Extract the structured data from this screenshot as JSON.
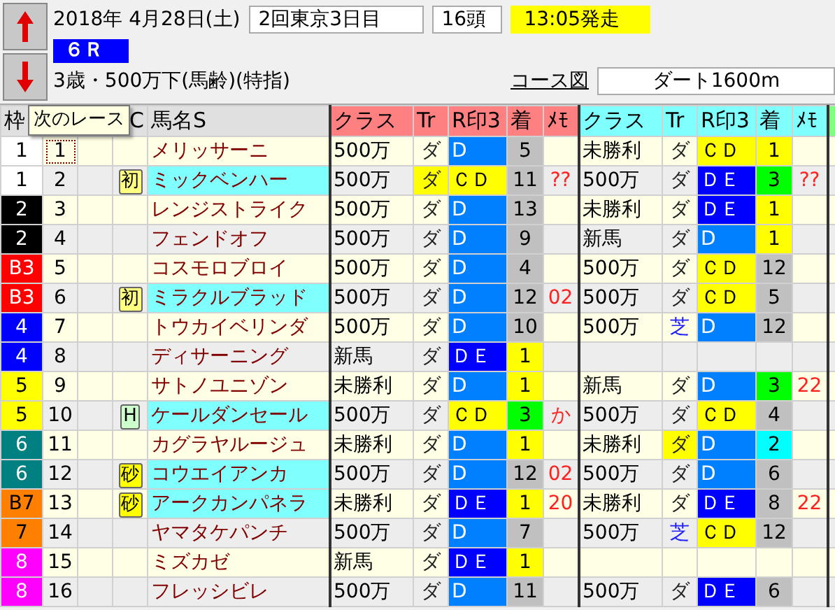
{
  "header": {
    "date": "2018年 4月28日(土)",
    "meeting": "2回東京3日目",
    "runners": "16頭",
    "start": "13:05発走",
    "race": "６Ｒ",
    "condition": "3歳・500万下(馬齢)(特指)",
    "course_link": "コース図",
    "course": "ダート1600m"
  },
  "tooltip": "次のレース",
  "table": {
    "columns": [
      {
        "label": "枠",
        "color": "#e0e0e0"
      },
      {
        "label": "C",
        "color": "#e0e0e0"
      },
      {
        "label": "馬名S",
        "color": "#e0e0e0"
      },
      {
        "label": "クラス",
        "color": "#ff8080"
      },
      {
        "label": "Tr",
        "color": "#ff8080"
      },
      {
        "label": "R印3",
        "color": "#ff8080"
      },
      {
        "label": "着",
        "color": "#ff8080"
      },
      {
        "label": "ﾒﾓ",
        "color": "#ff8080"
      },
      {
        "label": "クラス",
        "color": "#80ffff"
      },
      {
        "label": "Tr",
        "color": "#80ffff"
      },
      {
        "label": "R印3",
        "color": "#80ffff"
      },
      {
        "label": "着",
        "color": "#80ffff"
      },
      {
        "label": "ﾒﾓ",
        "color": "#80ffff"
      },
      {
        "color": "#80ff80"
      }
    ],
    "rows": [
      {
        "waku": {
          "text": "1",
          "color": "#ffffff"
        },
        "number": "1",
        "selected": true,
        "name": "メリッサーニ",
        "name_highlighted": false,
        "runs": [
          {
            "kind": "result",
            "class": "500万",
            "track": {
              "text": "ダ",
              "kind": "dirt",
              "highlighted": false
            },
            "grade": {
              "text": "D",
              "color": "#0080ff"
            },
            "rank": {
              "text": "5",
              "color": "#c0c0c0"
            }
          },
          {
            "kind": "result",
            "class": "未勝利",
            "track": {
              "text": "ダ",
              "kind": "dirt",
              "highlighted": false
            },
            "grade": {
              "text": "ＣＤ",
              "color": "#ffff00"
            },
            "rank": {
              "text": "1",
              "color": "#ffff00"
            }
          }
        ]
      },
      {
        "waku": {
          "text": "1",
          "color": "#ffffff"
        },
        "number": "2",
        "selected": false,
        "mark": {
          "text": "初",
          "color": "#ffff80"
        },
        "name": "ミックベンハー",
        "name_highlighted": true,
        "runs": [
          {
            "kind": "result",
            "class": "500万",
            "track": {
              "text": "ダ",
              "kind": "dirt",
              "highlighted": true
            },
            "grade": {
              "text": "ＣＤ",
              "color": "#ffff00"
            },
            "rank": {
              "text": "11",
              "color": "#c0c0c0"
            },
            "memo": "??"
          },
          {
            "kind": "result",
            "class": "500万",
            "track": {
              "text": "ダ",
              "kind": "dirt",
              "highlighted": false
            },
            "grade": {
              "text": "ＤＥ",
              "color": "#0000ff"
            },
            "rank": {
              "text": "3",
              "color": "#00ff00"
            },
            "memo": "??"
          }
        ]
      },
      {
        "waku": {
          "text": "2",
          "color": "#000000"
        },
        "number": "3",
        "selected": false,
        "name": "レンジストライク",
        "name_highlighted": false,
        "runs": [
          {
            "kind": "result",
            "class": "500万",
            "track": {
              "text": "ダ",
              "kind": "dirt",
              "highlighted": false
            },
            "grade": {
              "text": "D",
              "color": "#0080ff"
            },
            "rank": {
              "text": "13",
              "color": "#c0c0c0"
            }
          },
          {
            "kind": "result",
            "class": "未勝利",
            "track": {
              "text": "ダ",
              "kind": "dirt",
              "highlighted": false
            },
            "grade": {
              "text": "ＤＥ",
              "color": "#0000ff"
            },
            "rank": {
              "text": "1",
              "color": "#ffff00"
            }
          }
        ]
      },
      {
        "waku": {
          "text": "2",
          "color": "#000000"
        },
        "number": "4",
        "selected": false,
        "name": "フェンドオフ",
        "name_highlighted": false,
        "runs": [
          {
            "kind": "result",
            "class": "500万",
            "track": {
              "text": "ダ",
              "kind": "dirt",
              "highlighted": false
            },
            "grade": {
              "text": "D",
              "color": "#0080ff"
            },
            "rank": {
              "text": "9",
              "color": "#c0c0c0"
            }
          },
          {
            "kind": "result",
            "class": "新馬",
            "track": {
              "text": "ダ",
              "kind": "dirt",
              "highlighted": false
            },
            "grade": {
              "text": "D",
              "color": "#0080ff"
            },
            "rank": {
              "text": "1",
              "color": "#ffff00"
            }
          }
        ]
      },
      {
        "waku": {
          "text": "B3",
          "color": "#ff0000"
        },
        "number": "5",
        "selected": false,
        "name": "コスモロブロイ",
        "name_highlighted": false,
        "runs": [
          {
            "kind": "result",
            "class": "500万",
            "track": {
              "text": "ダ",
              "kind": "dirt",
              "highlighted": false
            },
            "grade": {
              "text": "D",
              "color": "#0080ff"
            },
            "rank": {
              "text": "4",
              "color": "#c0c0c0"
            }
          },
          {
            "kind": "result",
            "class": "500万",
            "track": {
              "text": "ダ",
              "kind": "dirt",
              "highlighted": false
            },
            "grade": {
              "text": "ＣＤ",
              "color": "#ffff00"
            },
            "rank": {
              "text": "12",
              "color": "#c0c0c0"
            }
          }
        ]
      },
      {
        "waku": {
          "text": "B3",
          "color": "#ff0000"
        },
        "number": "6",
        "selected": false,
        "mark": {
          "text": "初",
          "color": "#ffff80"
        },
        "name": "ミラクルブラッド",
        "name_highlighted": true,
        "runs": [
          {
            "kind": "result",
            "class": "500万",
            "track": {
              "text": "ダ",
              "kind": "dirt",
              "highlighted": false
            },
            "grade": {
              "text": "D",
              "color": "#0080ff"
            },
            "rank": {
              "text": "12",
              "color": "#c0c0c0"
            },
            "memo": "02"
          },
          {
            "kind": "result",
            "class": "500万",
            "track": {
              "text": "ダ",
              "kind": "dirt",
              "highlighted": false
            },
            "grade": {
              "text": "ＣＤ",
              "color": "#ffff00"
            },
            "rank": {
              "text": "5",
              "color": "#c0c0c0"
            }
          }
        ]
      },
      {
        "waku": {
          "text": "4",
          "color": "#0000ff"
        },
        "number": "7",
        "selected": false,
        "name": "トウカイベリンダ",
        "name_highlighted": false,
        "runs": [
          {
            "kind": "result",
            "class": "500万",
            "track": {
              "text": "ダ",
              "kind": "dirt",
              "highlighted": false
            },
            "grade": {
              "text": "D",
              "color": "#0080ff"
            },
            "rank": {
              "text": "10",
              "color": "#c0c0c0"
            }
          },
          {
            "kind": "result",
            "class": "500万",
            "track": {
              "text": "芝",
              "kind": "turf",
              "highlighted": false
            },
            "grade": {
              "text": "D",
              "color": "#0080ff"
            },
            "rank": {
              "text": "12",
              "color": "#c0c0c0"
            }
          }
        ]
      },
      {
        "waku": {
          "text": "4",
          "color": "#0000ff"
        },
        "number": "8",
        "selected": false,
        "name": "ディサーニング",
        "name_highlighted": false,
        "runs": [
          {
            "kind": "result",
            "class": "新馬",
            "track": {
              "text": "ダ",
              "kind": "dirt",
              "highlighted": false
            },
            "grade": {
              "text": "ＤＥ",
              "color": "#0000ff"
            },
            "rank": {
              "text": "1",
              "color": "#ffff00"
            }
          },
          {
            "kind": "blank"
          }
        ]
      },
      {
        "waku": {
          "text": "5",
          "color": "#ffff00"
        },
        "number": "9",
        "selected": false,
        "name": "サトノユニゾン",
        "name_highlighted": false,
        "runs": [
          {
            "kind": "result",
            "class": "未勝利",
            "track": {
              "text": "ダ",
              "kind": "dirt",
              "highlighted": false
            },
            "grade": {
              "text": "D",
              "color": "#0080ff"
            },
            "rank": {
              "text": "1",
              "color": "#ffff00"
            }
          },
          {
            "kind": "result",
            "class": "新馬",
            "track": {
              "text": "ダ",
              "kind": "dirt",
              "highlighted": false
            },
            "grade": {
              "text": "D",
              "color": "#0080ff"
            },
            "rank": {
              "text": "3",
              "color": "#00ff00"
            },
            "memo": "22"
          }
        ]
      },
      {
        "waku": {
          "text": "5",
          "color": "#ffff00"
        },
        "number": "10",
        "selected": false,
        "mark": {
          "text": "H",
          "color": "#ccffcc"
        },
        "name": "ケールダンセール",
        "name_highlighted": true,
        "runs": [
          {
            "kind": "result",
            "class": "500万",
            "track": {
              "text": "ダ",
              "kind": "dirt",
              "highlighted": false
            },
            "grade": {
              "text": "ＣＤ",
              "color": "#ffff00"
            },
            "rank": {
              "text": "3",
              "color": "#00ff00"
            },
            "memo": "か"
          },
          {
            "kind": "result",
            "class": "500万",
            "track": {
              "text": "ダ",
              "kind": "dirt",
              "highlighted": false
            },
            "grade": {
              "text": "ＣＤ",
              "color": "#ffff00"
            },
            "rank": {
              "text": "4",
              "color": "#c0c0c0"
            }
          }
        ]
      },
      {
        "waku": {
          "text": "6",
          "color": "#008080"
        },
        "number": "11",
        "selected": false,
        "name": "カグラヤルージュ",
        "name_highlighted": false,
        "runs": [
          {
            "kind": "result",
            "class": "未勝利",
            "track": {
              "text": "ダ",
              "kind": "dirt",
              "highlighted": false
            },
            "grade": {
              "text": "D",
              "color": "#0080ff"
            },
            "rank": {
              "text": "1",
              "color": "#ffff00"
            }
          },
          {
            "kind": "result",
            "class": "未勝利",
            "track": {
              "text": "ダ",
              "kind": "dirt",
              "highlighted": true
            },
            "grade": {
              "text": "D",
              "color": "#0080ff"
            },
            "rank": {
              "text": "2",
              "color": "#00ffff"
            }
          }
        ]
      },
      {
        "waku": {
          "text": "6",
          "color": "#008080"
        },
        "number": "12",
        "selected": false,
        "mark": {
          "text": "砂",
          "color": "#ffff00"
        },
        "name": "コウエイアンカ",
        "name_highlighted": true,
        "runs": [
          {
            "kind": "result",
            "class": "500万",
            "track": {
              "text": "ダ",
              "kind": "dirt",
              "highlighted": false
            },
            "grade": {
              "text": "D",
              "color": "#0080ff"
            },
            "rank": {
              "text": "12",
              "color": "#c0c0c0"
            },
            "memo": "02"
          },
          {
            "kind": "result",
            "class": "500万",
            "track": {
              "text": "ダ",
              "kind": "dirt",
              "highlighted": false
            },
            "grade": {
              "text": "D",
              "color": "#0080ff"
            },
            "rank": {
              "text": "6",
              "color": "#c0c0c0"
            }
          }
        ]
      },
      {
        "waku": {
          "text": "B7",
          "color": "#ff8000"
        },
        "number": "13",
        "selected": false,
        "mark": {
          "text": "砂",
          "color": "#ffff00"
        },
        "name": "アークカンパネラ",
        "name_highlighted": true,
        "runs": [
          {
            "kind": "result",
            "class": "未勝利",
            "track": {
              "text": "ダ",
              "kind": "dirt",
              "highlighted": false
            },
            "grade": {
              "text": "ＤＥ",
              "color": "#0000ff"
            },
            "rank": {
              "text": "1",
              "color": "#ffff00"
            },
            "memo": "20"
          },
          {
            "kind": "result",
            "class": "未勝利",
            "track": {
              "text": "ダ",
              "kind": "dirt",
              "highlighted": false
            },
            "grade": {
              "text": "ＤＥ",
              "color": "#0000ff"
            },
            "rank": {
              "text": "8",
              "color": "#c0c0c0"
            },
            "memo": "22"
          }
        ]
      },
      {
        "waku": {
          "text": "7",
          "color": "#ff8000"
        },
        "number": "14",
        "selected": false,
        "name": "ヤマタケパンチ",
        "name_highlighted": false,
        "runs": [
          {
            "kind": "result",
            "class": "500万",
            "track": {
              "text": "ダ",
              "kind": "dirt",
              "highlighted": false
            },
            "grade": {
              "text": "D",
              "color": "#0080ff"
            },
            "rank": {
              "text": "7",
              "color": "#c0c0c0"
            }
          },
          {
            "kind": "result",
            "class": "500万",
            "track": {
              "text": "芝",
              "kind": "turf",
              "highlighted": false
            },
            "grade": {
              "text": "ＣＤ",
              "color": "#ffff00"
            },
            "rank": {
              "text": "12",
              "color": "#c0c0c0"
            }
          }
        ]
      },
      {
        "waku": {
          "text": "8",
          "color": "#ff00ff"
        },
        "number": "15",
        "selected": false,
        "name": "ミズカゼ",
        "name_highlighted": false,
        "runs": [
          {
            "kind": "result",
            "class": "新馬",
            "track": {
              "text": "ダ",
              "kind": "dirt",
              "highlighted": false
            },
            "grade": {
              "text": "ＤＥ",
              "color": "#0000ff"
            },
            "rank": {
              "text": "1",
              "color": "#ffff00"
            }
          },
          {
            "kind": "blank"
          }
        ]
      },
      {
        "waku": {
          "text": "8",
          "color": "#ff00ff"
        },
        "number": "16",
        "selected": false,
        "name": "フレッシビレ",
        "name_highlighted": false,
        "runs": [
          {
            "kind": "result",
            "class": "500万",
            "track": {
              "text": "ダ",
              "kind": "dirt",
              "highlighted": false
            },
            "grade": {
              "text": "D",
              "color": "#0080ff"
            },
            "rank": {
              "text": "11",
              "color": "#c0c0c0"
            }
          },
          {
            "kind": "result",
            "class": "500万",
            "track": {
              "text": "ダ",
              "kind": "dirt",
              "highlighted": false
            },
            "grade": {
              "text": "ＤＥ",
              "color": "#0000ff"
            },
            "rank": {
              "text": "6",
              "color": "#c0c0c0"
            }
          }
        ]
      }
    ]
  }
}
